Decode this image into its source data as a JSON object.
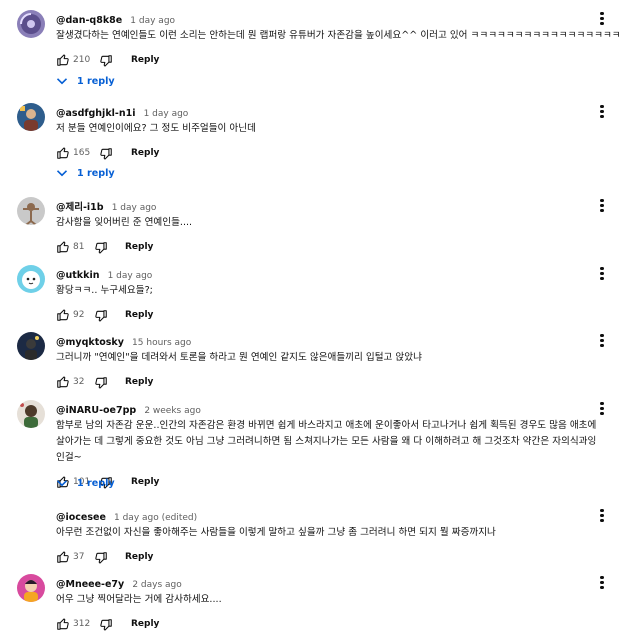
{
  "reply_label": "Reply",
  "colors": {
    "accent": "#065fd4",
    "text": "#0f0f0f",
    "muted": "#606060"
  },
  "icons": {
    "like": "thumbs-up-icon",
    "dislike": "thumbs-down-icon",
    "menu": "more-vert-icon",
    "replies": "chevron-down-icon"
  },
  "comments": [
    {
      "author": "@dan-q8k8e",
      "time": "1 day ago",
      "text": "잘생겼다하는 연예인들도 이런 소리는 안하는데 뭔 랩퍼랑 유튜버가 자존감을 높이세요^^ 이러고 있어 ㅋㅋㅋㅋㅋㅋㅋㅋㅋㅋㅋㅋㅋㅋㅋㅋㅋ",
      "likes": "210",
      "replies": "1 reply"
    },
    {
      "author": "@asdfghjkl-n1i",
      "time": "1 day ago",
      "text": "저 분들 연예인이에요? 그 정도 비주얼들이 아닌데",
      "likes": "165",
      "replies": "1 reply"
    },
    {
      "author": "@제리-i1b",
      "time": "1 day ago",
      "text": "감사함을 잊어버린 준 연예인들....",
      "likes": "81"
    },
    {
      "author": "@utkkin",
      "time": "1 day ago",
      "text": "황당ㅋㅋ.. 누구세요들?;",
      "likes": "92"
    },
    {
      "author": "@myqktosky",
      "time": "15 hours ago",
      "text": "그러니까 \"연예인\"을 데려와서 토론을 하라고 뭔 연예인 같지도 않은애들끼리 입털고 앉았냐",
      "likes": "32"
    },
    {
      "author": "@iNARU-oe7pp",
      "time": "2 weeks ago",
      "text": "함부로 남의 자존감 운운..인간의 자존감은 환경 바뀌면 쉽게 바스라지고 애초에 운이좋아서 타고나거나 쉽게 획득된 경우도 많음 애초에 살아가는 데 그렇게 중요한 것도 아님 그냥 그러려니하면 됨 스쳐지나가는 모든 사람을 왜 다 이해하려고 해 그것조차 약간은 자의식과잉인걸~",
      "likes": "101",
      "replies": "1 reply"
    },
    {
      "author": "@iocesee",
      "time": "1 day ago (edited)",
      "text": "아무런 조건없이 자신을 좋아해주는 사람들을 이렇게 말하고 싶을까 그냥 좀 그러려니 하면 되지 뭘 짜증까지나",
      "likes": "37"
    },
    {
      "author": "@Mneee-e7y",
      "time": "2 days ago",
      "text": "어우 그냥 찍어달라는 거에 감사하세요....",
      "likes": "312"
    }
  ]
}
